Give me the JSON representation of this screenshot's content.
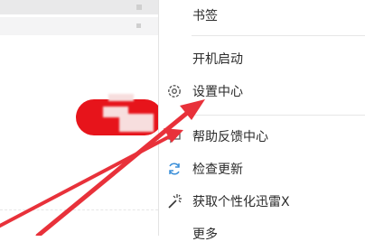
{
  "menu": {
    "items": [
      {
        "label": "书签",
        "icon": "none"
      },
      {
        "label": "开机启动",
        "icon": "none"
      },
      {
        "label": "设置中心",
        "icon": "gear-icon"
      },
      {
        "label": "帮助反馈中心",
        "icon": "feedback-icon"
      },
      {
        "label": "检查更新",
        "icon": "refresh-icon"
      },
      {
        "label": "获取个性化迅雷X",
        "icon": "magic-wand-icon"
      },
      {
        "label": "更多",
        "icon": "none"
      }
    ]
  },
  "colors": {
    "annotation_arrow": "#e8313a",
    "red_button": "#e7141b",
    "refresh_icon": "#3b8fd9"
  }
}
